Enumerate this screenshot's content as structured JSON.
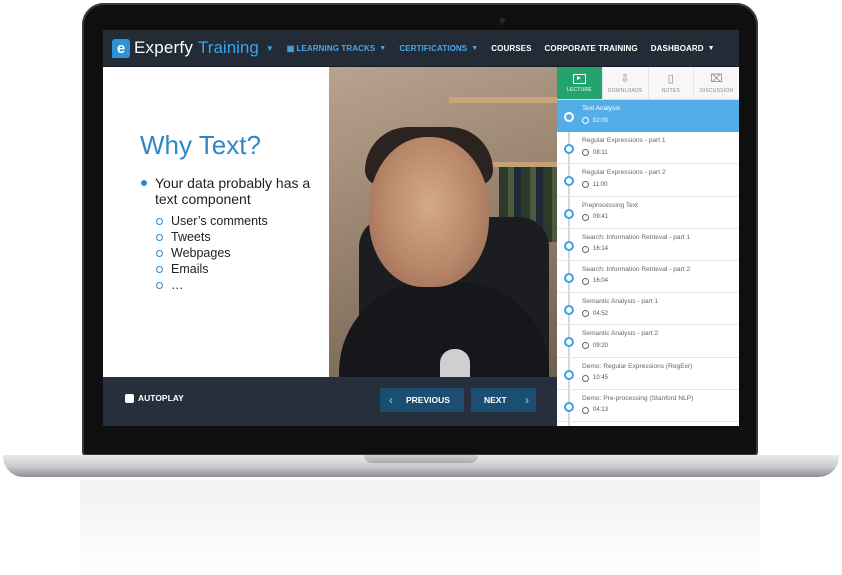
{
  "header": {
    "logo_letter": "e",
    "logo_word": "Experfy",
    "logo_word2": "Training",
    "nav": [
      {
        "label": "LEARNING TRACKS",
        "color": "#4aa7e8"
      },
      {
        "label": "CERTIFICATIONS",
        "color": "#4aa7e8"
      },
      {
        "label": "COURSES",
        "color": "#ffffff"
      },
      {
        "label": "CORPORATE TRAINING",
        "color": "#ffffff"
      },
      {
        "label": "DASHBOARD",
        "color": "#ffffff"
      }
    ]
  },
  "slide": {
    "title": "Why Text?",
    "bullet": "Your data probably has a text component",
    "sub_items": [
      "User’s comments",
      "Tweets",
      "Webpages",
      "Emails",
      "…"
    ]
  },
  "sidebar": {
    "tabs": [
      {
        "label": "LECTURE",
        "icon": "play-icon",
        "active": true
      },
      {
        "label": "DOWNLOADS",
        "icon": "download-icon",
        "active": false
      },
      {
        "label": "NOTES",
        "icon": "notes-icon",
        "active": false
      },
      {
        "label": "DISCUSSION",
        "icon": "discussion-icon",
        "active": false
      }
    ],
    "lessons": [
      {
        "title": "Text Analysis",
        "duration": "02:00",
        "active": true
      },
      {
        "title": "Regular Expressions - part 1",
        "duration": "08:11",
        "active": false
      },
      {
        "title": "Regular Expressions - part 2",
        "duration": "11:00",
        "active": false
      },
      {
        "title": "Preprocessing Text",
        "duration": "09:41",
        "active": false
      },
      {
        "title": "Search: Information Retrieval - part 1",
        "duration": "16:14",
        "active": false
      },
      {
        "title": "Search: Information Retrieval - part 2",
        "duration": "16:04",
        "active": false
      },
      {
        "title": "Semantic Analysis - part 1",
        "duration": "04:52",
        "active": false
      },
      {
        "title": "Semantic Analysis - part 2",
        "duration": "09:20",
        "active": false
      },
      {
        "title": "Demo: Regular Expressions (RegExr)",
        "duration": "10:45",
        "active": false
      },
      {
        "title": "Demo: Pre-processing (Stanford NLP)",
        "duration": "04:13",
        "active": false
      }
    ]
  },
  "controls": {
    "autoplay_label": "AUTOPLAY",
    "previous_label": "PREVIOUS",
    "next_label": "NEXT"
  },
  "colors": {
    "accent_blue": "#39a3e6",
    "active_tab_green": "#25a36f",
    "active_lesson_blue": "#53aee8",
    "button_blue": "#1b4e70"
  }
}
